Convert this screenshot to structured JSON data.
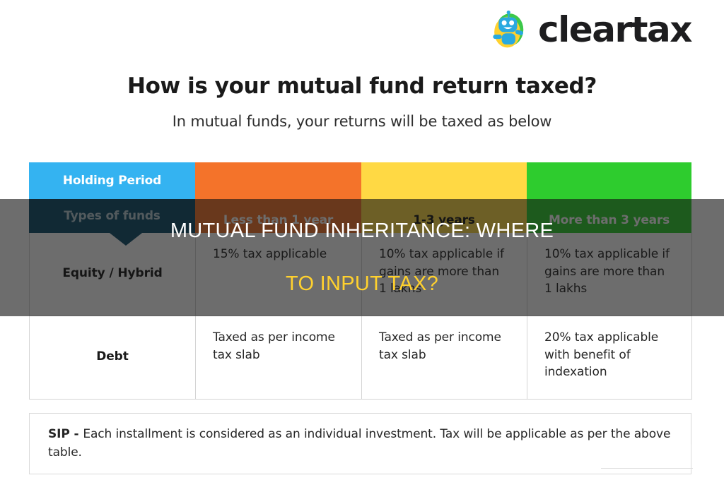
{
  "brand": {
    "name": "cleartax",
    "logo_icon": "cleartax-robot-logo",
    "colors": {
      "text": "#1d1d1f",
      "robot_blue": "#29a9e0",
      "robot_yellow": "#ffd12e",
      "robot_green": "#3cc84a"
    }
  },
  "headline": "How is your mutual fund return taxed?",
  "subhead": "In mutual funds, your returns will be taxed as below",
  "table": {
    "corner": {
      "top_label": "Holding Period",
      "bottom_label": "Types of funds",
      "top_color": "#34b3f1",
      "bottom_color": "#0e4c6b"
    },
    "columns": [
      {
        "label": "Less than 1 year",
        "bg": "#f4732a",
        "fg": "#ffffff"
      },
      {
        "label": "1-3 years",
        "bg": "#ffd944",
        "fg": "#1a1a1a"
      },
      {
        "label": "More than 3 years",
        "bg": "#2ecc2e",
        "fg": "#ffffff"
      }
    ],
    "rows": [
      {
        "label": "Equity / Hybrid",
        "cells": [
          "15% tax applicable",
          "10% tax applicable if gains are more than 1 lakhs",
          "10% tax applicable if gains are more than 1 lakhs"
        ]
      },
      {
        "label": "Debt",
        "cells": [
          "Taxed as per income tax slab",
          "Taxed as per income tax slab",
          "20% tax applicable with benefit of indexation"
        ]
      }
    ]
  },
  "note": {
    "prefix": "SIP - ",
    "text": "Each installment is considered as an individual investment. Tax will be applicable as per the above table."
  },
  "overlay": {
    "line1": "MUTUAL FUND INHERITANCE: WHERE",
    "line2": "TO INPUT TAX?",
    "line1_color": "#ffffff",
    "line2_color": "#ffd12e",
    "scrim": "rgba(20,20,20,0.62)"
  }
}
